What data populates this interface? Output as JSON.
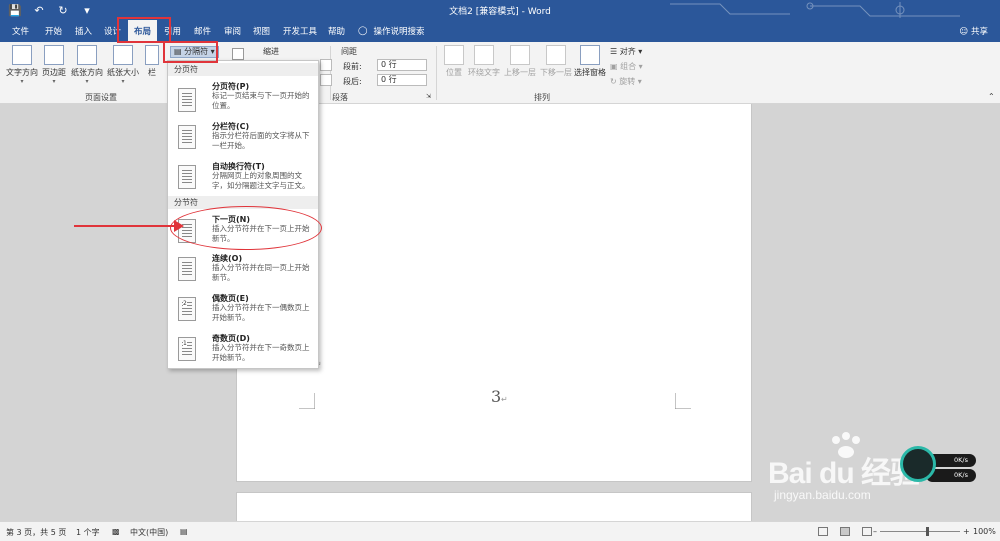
{
  "title_bar": {
    "doc_title": "文档2 [兼容模式] - Word"
  },
  "tabs": [
    {
      "label": "文件"
    },
    {
      "label": "开始"
    },
    {
      "label": "插入"
    },
    {
      "label": "设计"
    },
    {
      "label": "布局"
    },
    {
      "label": "引用"
    },
    {
      "label": "邮件"
    },
    {
      "label": "审阅"
    },
    {
      "label": "视图"
    },
    {
      "label": "开发工具"
    },
    {
      "label": "帮助"
    }
  ],
  "help_search": "操作说明搜索",
  "share": "共享",
  "ribbon": {
    "page_setup": {
      "buttons": [
        "文字方向",
        "页边距",
        "纸张方向",
        "纸张大小",
        "栏"
      ],
      "group_label": "页面设置"
    },
    "breaks_button": "分隔符",
    "indent_label": "缩进",
    "spacing_label": "间距",
    "spacing_before_label": "段前:",
    "spacing_before_value": "0 行",
    "spacing_after_label": "段后:",
    "spacing_after_value": "0 行",
    "paragraph_group_label": "段落",
    "arrange": {
      "buttons": [
        "位置",
        "环绕文字",
        "上移一层",
        "下移一层"
      ],
      "selection_pane": "选择窗格",
      "align": "对齐",
      "group": "组合",
      "rotate": "旋转",
      "group_label": "排列"
    }
  },
  "breaks_menu": {
    "page_breaks_header": "分页符",
    "section_breaks_header": "分节符",
    "items": [
      {
        "title": "分页符(P)",
        "desc": "标记一页结束与下一页开始的位置。"
      },
      {
        "title": "分栏符(C)",
        "desc": "指示分栏符后面的文字将从下一栏开始。"
      },
      {
        "title": "自动换行符(T)",
        "desc": "分隔网页上的对象周围的文字，如分隔题注文字与正文。"
      },
      {
        "title": "下一页(N)",
        "desc": "插入分节符并在下一页上开始新节。"
      },
      {
        "title": "连续(O)",
        "desc": "插入分节符并在同一页上开始新节。"
      },
      {
        "title": "偶数页(E)",
        "desc": "插入分节符并在下一偶数页上开始新节。"
      },
      {
        "title": "奇数页(D)",
        "desc": "插入分节符并在下一奇数页上开始新节。"
      }
    ],
    "even_icon_label": "2",
    "odd_icon_label": "1"
  },
  "document": {
    "page_number": "3"
  },
  "status_bar": {
    "page_info": "第 3 页，共 5 页",
    "word_count": "1 个字",
    "language": "中文(中国)",
    "zoom": "100%"
  },
  "watermark": {
    "brand": "Bai du 经验",
    "url": "jingyan.baidu.com"
  },
  "speed_widget": {
    "upload": "0K/s",
    "download": "0K/s"
  },
  "colors": {
    "title_bar": "#2b579a",
    "annotation": "#e0343a"
  }
}
